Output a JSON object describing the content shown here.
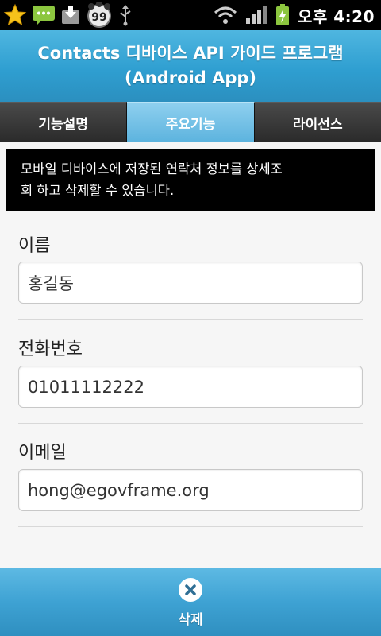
{
  "status_bar": {
    "icons": [
      "star-icon",
      "message-icon",
      "download-icon",
      "notification-badge-icon",
      "usb-icon",
      "wifi-icon",
      "signal-icon",
      "battery-charging-icon"
    ],
    "badge_count": "99",
    "time": "오후 4:20"
  },
  "header": {
    "title_line1": "Contacts 디바이스 API 가이드 프로그램",
    "title_line2": "(Android App)"
  },
  "tabs": [
    {
      "label": "기능설명",
      "active": false
    },
    {
      "label": "주요기능",
      "active": true
    },
    {
      "label": "라이선스",
      "active": false
    }
  ],
  "description": {
    "line1": "모바일 디바이스에 저장된 연락처 정보를 상세조",
    "line2": "회 하고 삭제할 수 있습니다."
  },
  "form": {
    "name": {
      "label": "이름",
      "value": "홍길동"
    },
    "phone": {
      "label": "전화번호",
      "value": "01011112222"
    },
    "email": {
      "label": "이메일",
      "value": "hong@egovframe.org"
    }
  },
  "footer": {
    "delete_label": "삭제",
    "delete_icon": "close-circle-icon"
  },
  "colors": {
    "header_blue": "#2f9fd1",
    "tab_active": "#6fbfe6",
    "tab_inactive": "#333333",
    "footer_blue": "#3ea2d3"
  }
}
